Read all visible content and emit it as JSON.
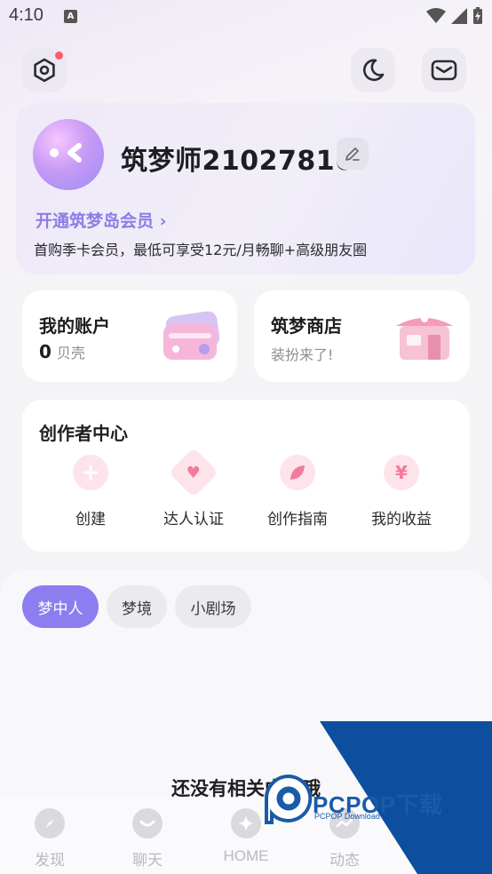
{
  "status_bar": {
    "time": "4:10",
    "notif_badge": "A"
  },
  "header": {
    "settings_icon": "hexagon-settings-icon",
    "theme_icon": "moon-icon",
    "mail_icon": "mail-icon"
  },
  "profile": {
    "username": "筑梦师21027816",
    "vip_link": "开通筑梦岛会员 ›",
    "vip_desc": "首购季卡会员，最低可享受12元/月畅聊+高级朋友圈"
  },
  "account_card": {
    "title": "我的账户",
    "balance": "0",
    "unit": "贝壳"
  },
  "shop_card": {
    "title": "筑梦商店",
    "subtitle": "装扮来了!"
  },
  "creator_center": {
    "title": "创作者中心",
    "items": [
      {
        "label": "创建",
        "icon": "plus-icon",
        "glyph": "+"
      },
      {
        "label": "达人认证",
        "icon": "heart-diamond-icon",
        "glyph": "♥"
      },
      {
        "label": "创作指南",
        "icon": "leaf-icon",
        "glyph": ""
      },
      {
        "label": "我的收益",
        "icon": "yen-icon",
        "glyph": "¥"
      }
    ]
  },
  "tabs": [
    {
      "label": "梦中人",
      "active": true
    },
    {
      "label": "梦境",
      "active": false
    },
    {
      "label": "小剧场",
      "active": false
    }
  ],
  "empty_state": "还没有相关内容哦",
  "bottom_nav": [
    {
      "label": "发现",
      "icon": "compass-icon"
    },
    {
      "label": "聊天",
      "icon": "chat-icon"
    },
    {
      "label": "HOME",
      "icon": "sparkle-icon"
    },
    {
      "label": "动态",
      "icon": "feed-icon"
    }
  ],
  "watermark": {
    "title": "PCPOP下载",
    "subtitle": "PCPOP Download"
  },
  "colors": {
    "accent": "#8c7df0",
    "vip_text": "#8c7de6",
    "badge": "#ff5a6a"
  }
}
